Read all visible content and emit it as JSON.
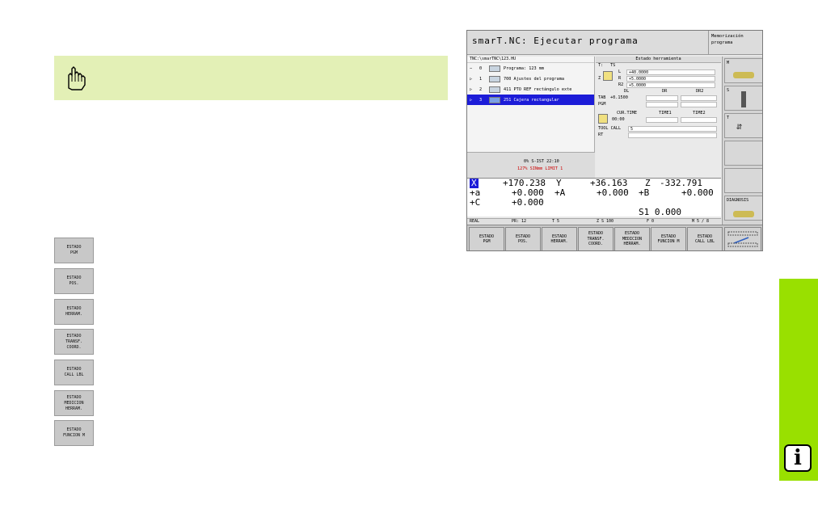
{
  "screen": {
    "title": "smarT.NC: Ejecutar programa",
    "mode": "Memorización\nprograma",
    "tree": {
      "path": "TNC:\\smarTNC\\123.HU",
      "rows": [
        {
          "exp": "−",
          "num": "0",
          "label": "Programa: 123 mm"
        },
        {
          "exp": "▷",
          "num": "1",
          "label": "700 Ajustes del programa"
        },
        {
          "exp": "▷",
          "num": "2",
          "label": "411 PTO REF rectángulo exte"
        },
        {
          "exp": "▷",
          "num": "3",
          "label": "251 Cajera rectangular"
        }
      ]
    },
    "status": {
      "line1": "0%  S-IST 22:10",
      "line2": "127% SINmm  LIMIT 1"
    },
    "tool": {
      "header": "Estado herramienta",
      "t_label": "T:",
      "t_value": "TS",
      "l_label": "L",
      "l_value": "+40.0000",
      "r_label": "R",
      "r_value": "+5.0000",
      "r2_label": "R2",
      "r2_value": "+5.0000",
      "z_label": "Z",
      "dl": "DL",
      "dr": "DR",
      "dr2": "DR2",
      "tab_label": "TAB",
      "tab_value": "+0.1500",
      "pgm_label": "PGM",
      "cur_time": "CUR.TIME",
      "time1": "TIME1",
      "time2": "TIME2",
      "cur_value": "00:00",
      "tool_call": "TOOL CALL",
      "tool_call_value": "5",
      "rt_label": "RT"
    },
    "positions": [
      {
        "a": "X",
        "av": "+170.238",
        "b": "Y",
        "bv": "+36.163",
        "c": "Z",
        "cv": "-332.791"
      },
      {
        "a": "+a",
        "av": "+0.000",
        "b": "+A",
        "bv": "+0.000",
        "c": "+B",
        "cv": "+0.000"
      },
      {
        "a": "+C",
        "av": "+0.000",
        "b": "",
        "bv": "",
        "c": "",
        "cv": ""
      }
    ],
    "spindle": "S1   0.000",
    "statbar": {
      "mode": "REAL",
      "pr": "PR: 12",
      "t": "T 5",
      "z": "Z S 100",
      "f": "F 0",
      "m": "M 5 / 8"
    },
    "side": [
      {
        "label": "M"
      },
      {
        "label": "S"
      },
      {
        "label": "T"
      },
      {
        "label": ""
      },
      {
        "label": ""
      },
      {
        "label": "DIAGNOSIS"
      }
    ],
    "softkeys": [
      "ESTADO\nPGM",
      "ESTADO\nPOS.",
      "ESTADO\nHERRAM.",
      "ESTADO\nTRANSF.\nCOORD.",
      "ESTADO\nMEDICION\nHERRAM.",
      "ESTADO\nFUNCION M",
      "ESTADO\nCALL LBL"
    ]
  },
  "left_buttons": [
    "ESTADO\nPGM",
    "ESTADO\nPOS.",
    "ESTADO\nHERRAM.",
    "ESTADO\nTRANSF.\nCOORD.",
    "ESTADO\nCALL LBL",
    "ESTADO\nMEDICION\nHERRAM.",
    "ESTADO\nFUNCION M"
  ],
  "info_icon": "i",
  "colors": {
    "note": "#e3f0b6",
    "green_tab": "#99e000",
    "selection": "#1c1cd8"
  }
}
